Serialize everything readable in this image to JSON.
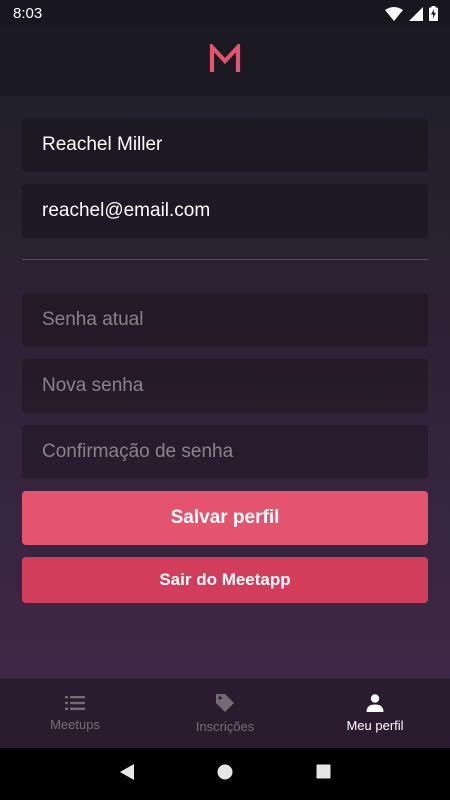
{
  "status_bar": {
    "time": "8:03",
    "icons": [
      "wifi-icon",
      "signal-icon",
      "battery-charging-icon"
    ]
  },
  "header": {
    "logo_icon": "meetapp-m-logo",
    "accent_color": "#e5546f"
  },
  "profile_form": {
    "name_value": "Reachel Miller",
    "email_value": "reachel@email.com",
    "current_password_placeholder": "Senha atual",
    "new_password_placeholder": "Nova senha",
    "confirm_password_placeholder": "Confirmação de senha",
    "save_label": "Salvar perfil",
    "logout_label": "Sair do Meetapp"
  },
  "tabs": [
    {
      "label": "Meetups",
      "icon": "list-icon",
      "active": false
    },
    {
      "label": "Inscrições",
      "icon": "tag-icon",
      "active": false
    },
    {
      "label": "Meu perfil",
      "icon": "person-icon",
      "active": true
    }
  ],
  "nav_bar": {
    "icons": [
      "back-icon",
      "home-icon",
      "recents-icon"
    ]
  },
  "colors": {
    "save_button": "#e5546f",
    "logout_button": "#d23d5c",
    "background_top": "#22202c",
    "background_bottom": "#3f2848"
  }
}
